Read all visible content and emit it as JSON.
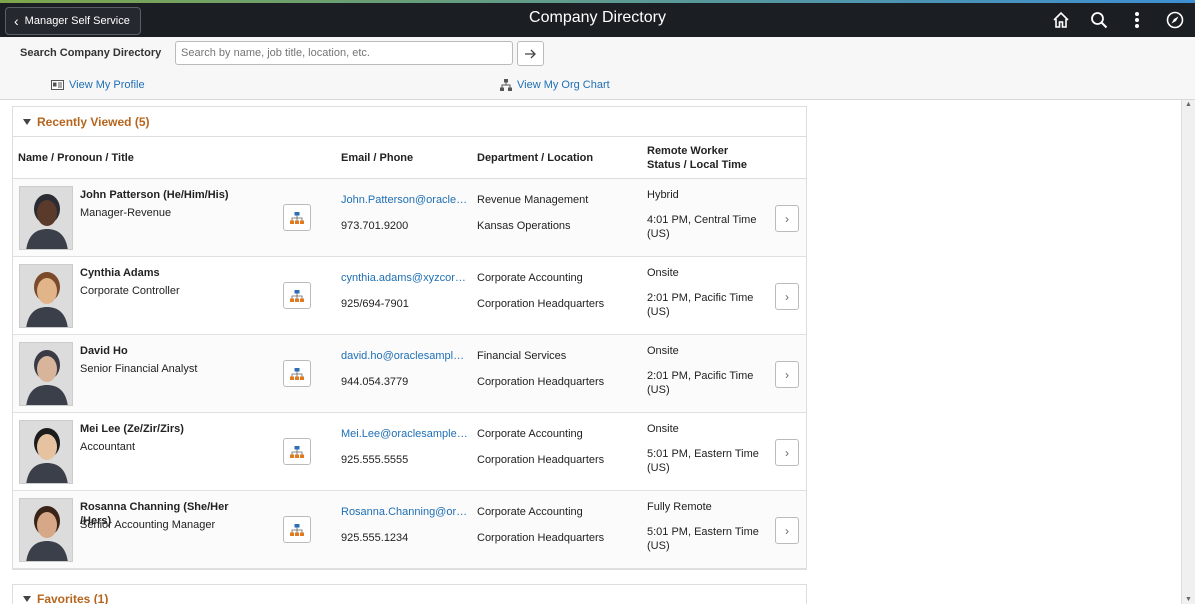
{
  "header": {
    "back_label": "Manager Self Service",
    "title": "Company Directory",
    "icons": [
      "home-icon",
      "search-icon",
      "more-icon",
      "navigator-icon"
    ]
  },
  "search": {
    "label": "Search Company Directory",
    "placeholder": "Search by name, job title, location, etc.",
    "value": ""
  },
  "links": {
    "profile": "View My Profile",
    "org_chart": "View My Org Chart"
  },
  "recently_viewed": {
    "heading": "Recently Viewed (5)",
    "columns": {
      "name": "Name / Pronoun / Title",
      "email": "Email / Phone",
      "dept": "Department / Location",
      "remote_line1": "Remote Worker",
      "remote_line2": "Status / Local Time"
    },
    "rows": [
      {
        "name": "John Patterson (He/Him/His)",
        "title": "Manager-Revenue",
        "email": "John.Patterson@oraclesample.com",
        "phone": "973.701.9200",
        "dept": "Revenue Management",
        "location": "Kansas Operations",
        "status": "Hybrid",
        "time": "4:01 PM, Central Time (US)"
      },
      {
        "name": "Cynthia Adams",
        "title": "Corporate Controller",
        "email": "cynthia.adams@xyzcorp.com",
        "phone": "925/694-7901",
        "dept": "Corporate Accounting",
        "location": "Corporation Headquarters",
        "status": "Onsite",
        "time": "2:01 PM, Pacific Time (US)"
      },
      {
        "name": "David Ho",
        "title": "Senior Financial Analyst",
        "email": "david.ho@oraclesample.com",
        "phone": "944.054.3779",
        "dept": "Financial Services",
        "location": "Corporation Headquarters",
        "status": "Onsite",
        "time": "2:01 PM, Pacific Time (US)"
      },
      {
        "name": "Mei Lee (Ze/Zir/Zirs)",
        "title": "Accountant",
        "email": "Mei.Lee@oraclesample.com",
        "phone": "925.555.5555",
        "dept": "Corporate Accounting",
        "location": "Corporation Headquarters",
        "status": "Onsite",
        "time": "5:01 PM, Eastern Time (US)"
      },
      {
        "name": "Rosanna Channing (She/Her /Hers)",
        "title": "Senior Accounting Manager",
        "email": "Rosanna.Channing@oraclesample.com",
        "phone": "925.555.1234",
        "dept": "Corporate Accounting",
        "location": "Corporation Headquarters",
        "status": "Fully Remote",
        "time": "5:01 PM, Eastern Time (US)"
      }
    ]
  },
  "favorites": {
    "heading": "Favorites (1)"
  },
  "colors": {
    "accent_link": "#1f6fb5",
    "section_heading": "#b5651d",
    "topbar": "#1b1e23"
  }
}
